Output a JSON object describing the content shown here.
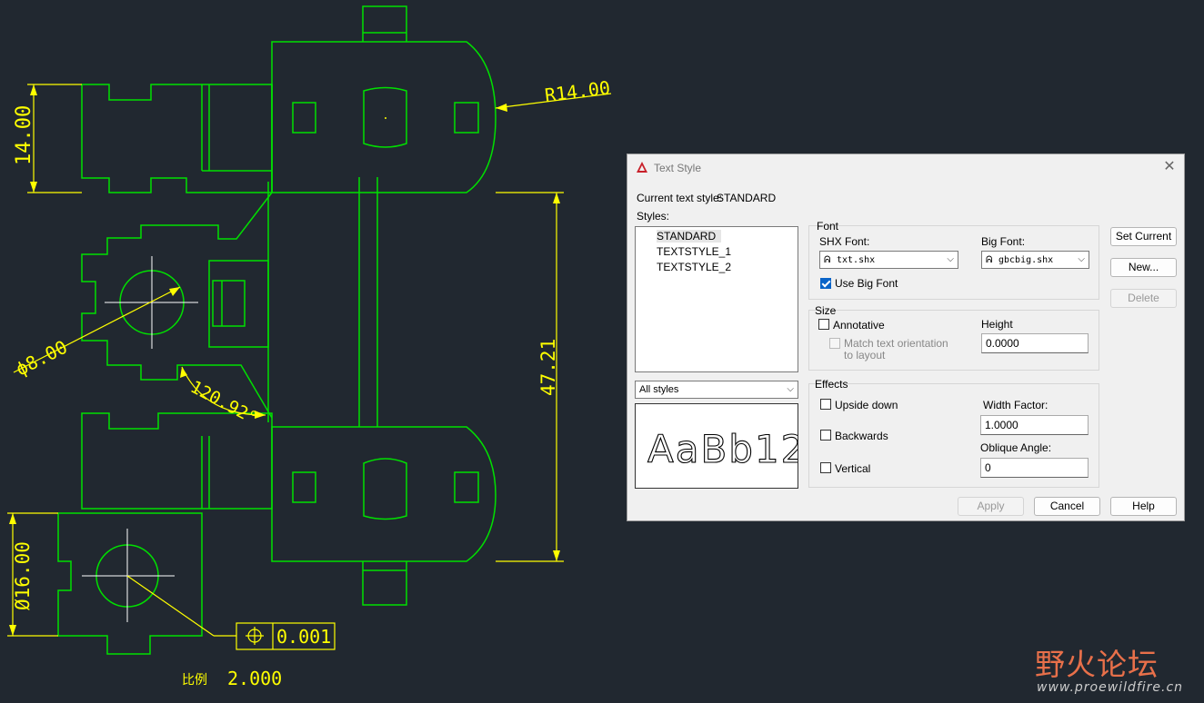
{
  "drawing": {
    "dimensions": {
      "left_height": "14.00",
      "radius": "R14.00",
      "right_height": "47.21",
      "hole_diameter": "ϕ8.00",
      "angle": "120.92°",
      "lower_diameter": "Ø16.00",
      "tolerance": "0.001"
    },
    "scale_label": "比例",
    "scale_value": "2.000"
  },
  "dialog": {
    "title": "Text Style",
    "current_style_label": "Current text style:",
    "current_style_value": "STANDARD",
    "styles_label": "Styles:",
    "styles": [
      "STANDARD",
      "TEXTSTYLE_1",
      "TEXTSTYLE_2"
    ],
    "filter_value": "All styles",
    "preview_text": "AaBb12",
    "font": {
      "group_title": "Font",
      "shx_label": "SHX Font:",
      "shx_value": "txt.shx",
      "big_label": "Big Font:",
      "big_value": "gbcbig.shx",
      "use_big_font": "Use Big Font"
    },
    "size": {
      "group_title": "Size",
      "annotative": "Annotative",
      "match_line1": "Match text orientation",
      "match_line2": "to layout",
      "height_label": "Height",
      "height_value": "0.0000"
    },
    "effects": {
      "group_title": "Effects",
      "upside_down": "Upside down",
      "backwards": "Backwards",
      "vertical": "Vertical",
      "width_factor_label": "Width Factor:",
      "width_factor_value": "1.0000",
      "oblique_label": "Oblique Angle:",
      "oblique_value": "0"
    },
    "buttons": {
      "set_current": "Set Current",
      "new": "New...",
      "delete": "Delete",
      "apply": "Apply",
      "cancel": "Cancel",
      "help": "Help"
    }
  },
  "watermark": {
    "logo": "野火论坛",
    "url": "www.proewildfire.cn"
  }
}
